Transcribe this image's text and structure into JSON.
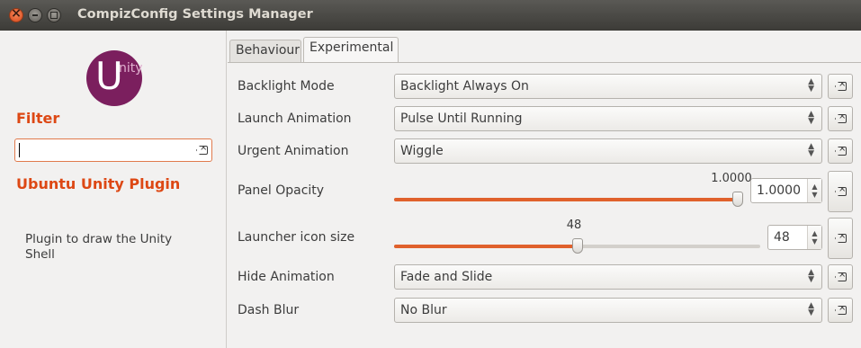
{
  "window": {
    "title": "CompizConfig Settings Manager"
  },
  "sidebar": {
    "logo_letter": "U",
    "logo_text": "nity",
    "filter_label": "Filter",
    "filter_value": "",
    "plugin_title": "Ubuntu Unity Plugin",
    "plugin_description": "Plugin to draw the Unity Shell"
  },
  "tabs": [
    {
      "label": "Behaviour",
      "active": false
    },
    {
      "label": "Experimental",
      "active": true
    }
  ],
  "settings": {
    "backlight_mode": {
      "label": "Backlight Mode",
      "value": "Backlight Always On"
    },
    "launch_animation": {
      "label": "Launch Animation",
      "value": "Pulse Until Running"
    },
    "urgent_animation": {
      "label": "Urgent Animation",
      "value": "Wiggle"
    },
    "panel_opacity": {
      "label": "Panel Opacity",
      "value": "1.0000",
      "slider_fraction": 1.0
    },
    "launcher_icon_size": {
      "label": "Launcher icon size",
      "value": "48",
      "slider_fraction": 0.5
    },
    "hide_animation": {
      "label": "Hide Animation",
      "value": "Fade and Slide"
    },
    "dash_blur": {
      "label": "Dash Blur",
      "value": "No Blur"
    }
  },
  "colors": {
    "accent": "#dd4814",
    "logo": "#7b1f5e",
    "slider_fill": "#e0612c"
  },
  "icons": [
    "close-icon",
    "minimize-icon",
    "maximize-icon",
    "clear-icon",
    "reset-icon",
    "spin-arrows-icon"
  ]
}
